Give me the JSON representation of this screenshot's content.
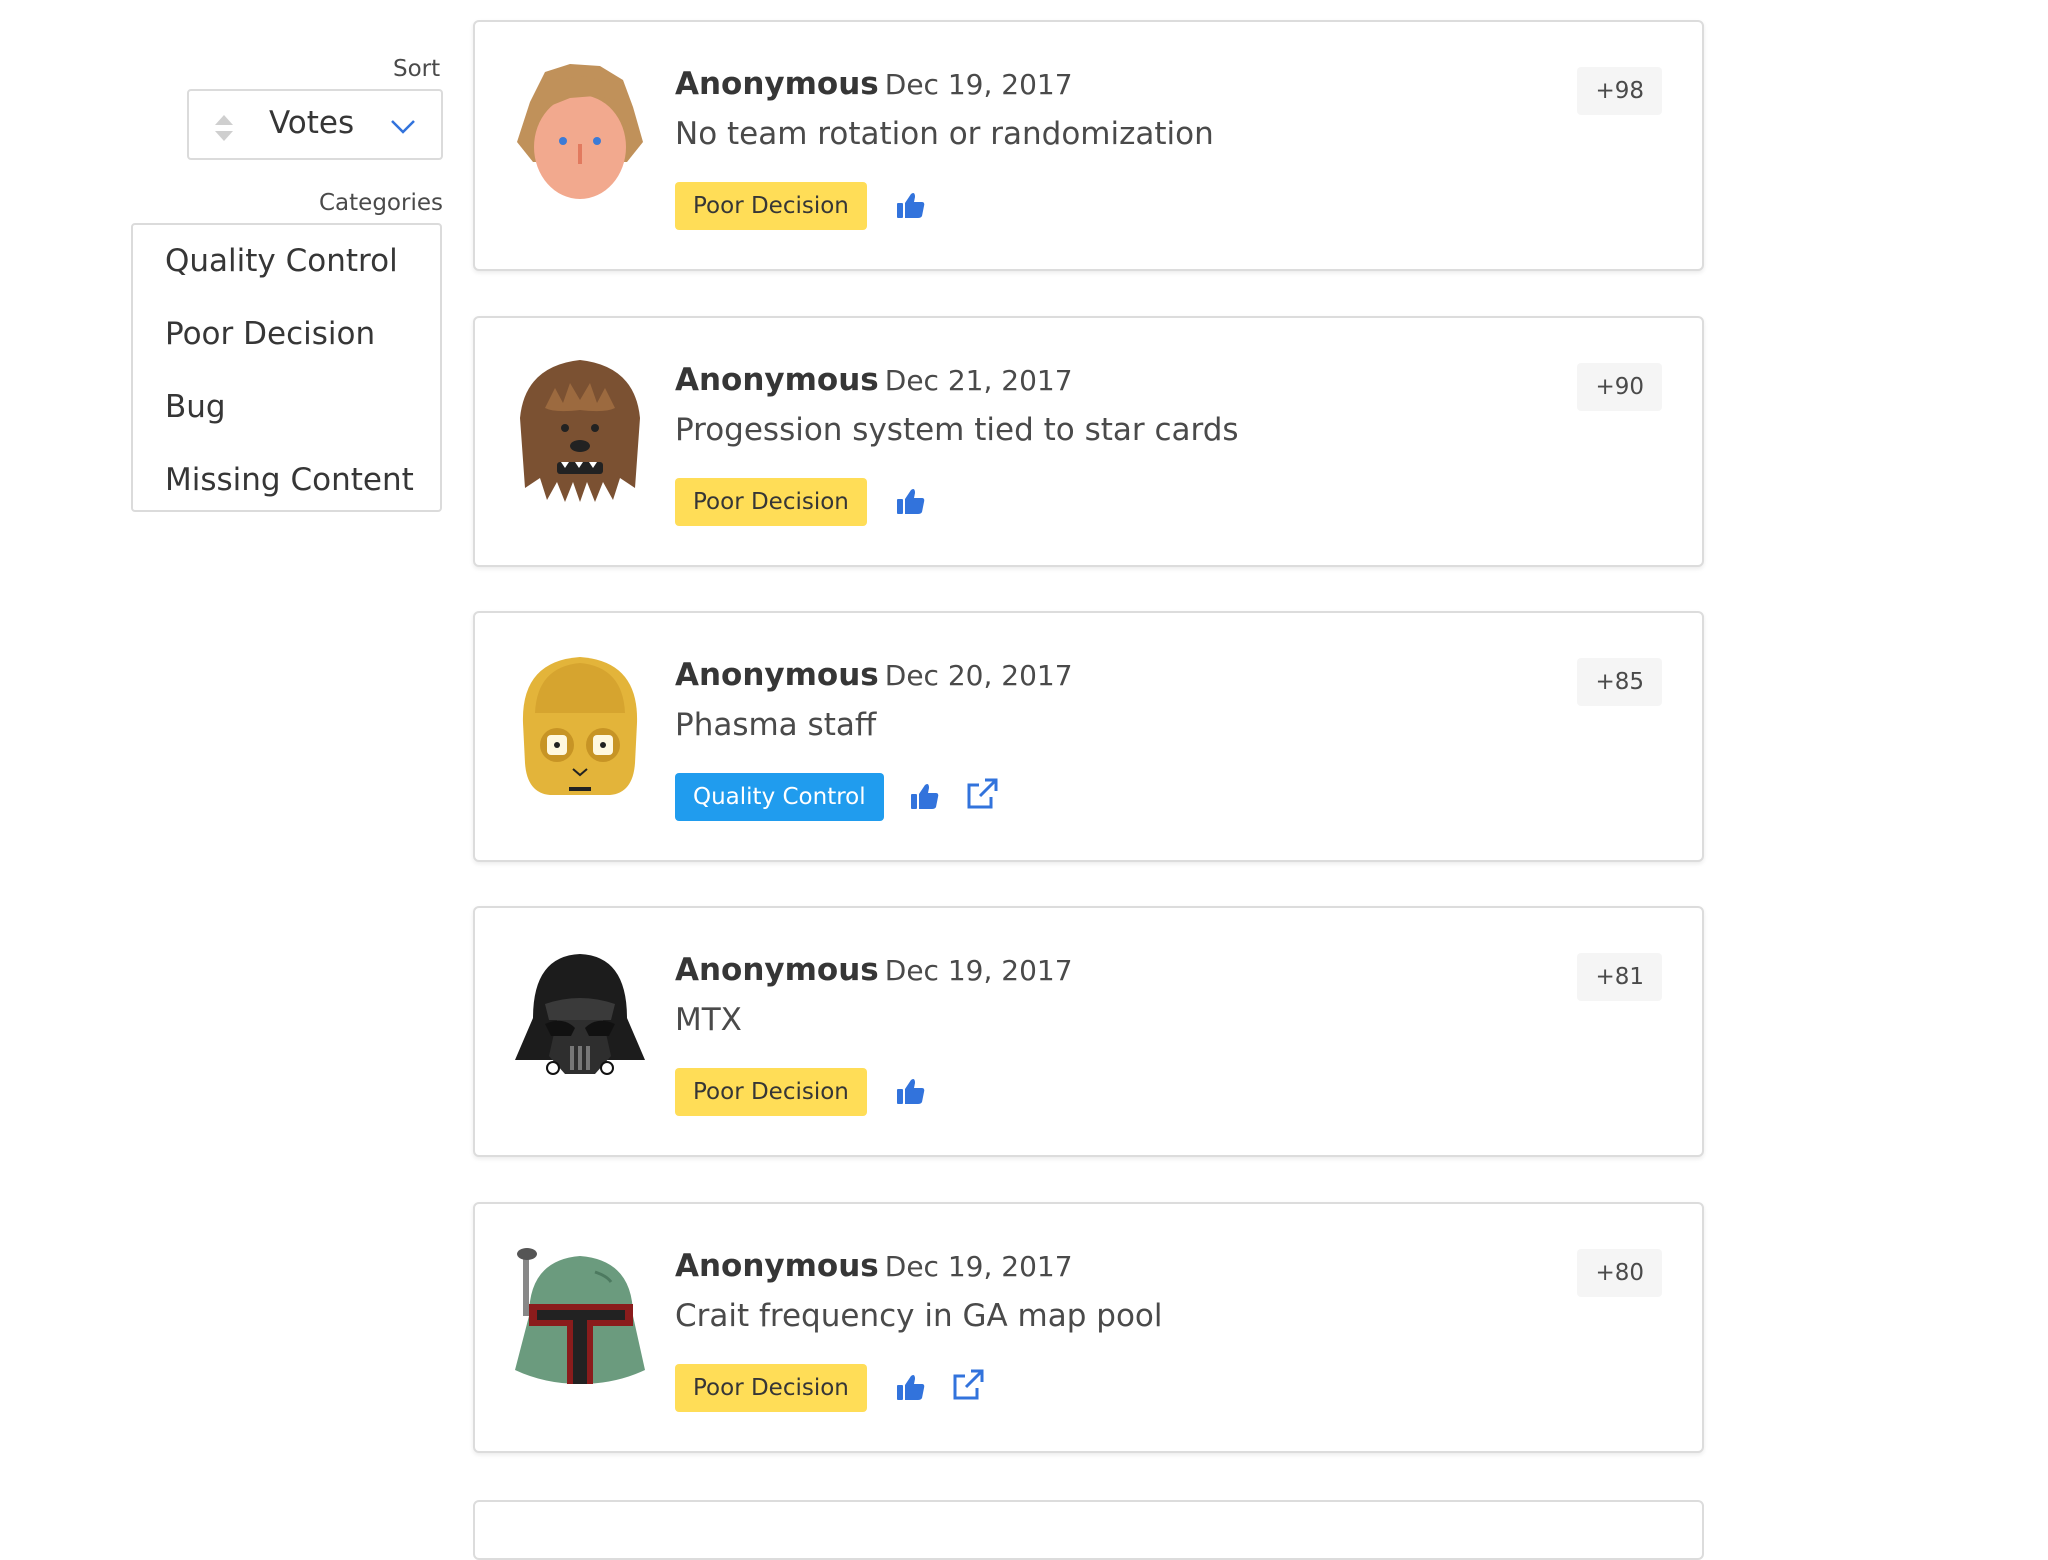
{
  "sort": {
    "label": "Sort",
    "value": "Votes"
  },
  "categories": {
    "label": "Categories",
    "items": [
      "Quality Control",
      "Poor Decision",
      "Bug",
      "Missing Content"
    ]
  },
  "colors": {
    "poor_decision": "#ffdd57",
    "quality_control": "#209cee",
    "link_blue": "#3273dc"
  },
  "posts": [
    {
      "author": "Anonymous",
      "date": "Dec 19, 2017",
      "title": "No team rotation or randomization",
      "tag": "Poor Decision",
      "votes": "+98",
      "avatar": "luke-avatar-icon"
    },
    {
      "author": "Anonymous",
      "date": "Dec 21, 2017",
      "title": "Progession system tied to star cards",
      "tag": "Poor Decision",
      "votes": "+90",
      "avatar": "chewbacca-avatar-icon"
    },
    {
      "author": "Anonymous",
      "date": "Dec 20, 2017",
      "title": "Phasma staff",
      "tag": "Quality Control",
      "votes": "+85",
      "avatar": "c3po-avatar-icon"
    },
    {
      "author": "Anonymous",
      "date": "Dec 19, 2017",
      "title": "MTX",
      "tag": "Poor Decision",
      "votes": "+81",
      "avatar": "vader-avatar-icon"
    },
    {
      "author": "Anonymous",
      "date": "Dec 19, 2017",
      "title": "Crait frequency in GA map pool",
      "tag": "Poor Decision",
      "votes": "+80",
      "avatar": "boba-fett-avatar-icon"
    }
  ]
}
